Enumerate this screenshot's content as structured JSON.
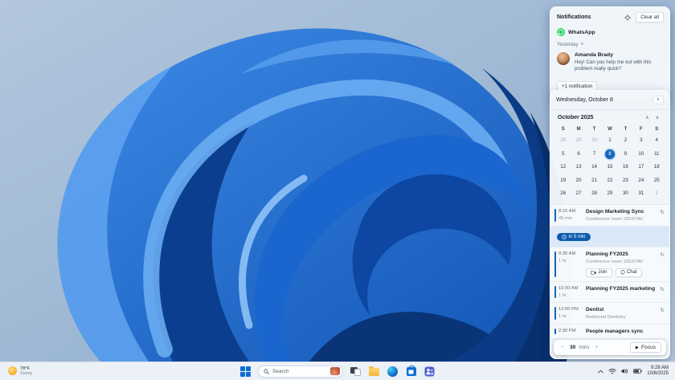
{
  "colors": {
    "accent": "#1466bc",
    "selected_day_bg": "#1266bc",
    "reminder_pill_bg": "#0f5cae",
    "whatsapp_green": "#25d366",
    "wallpaper_blue_bright": "#3e8ae8",
    "wallpaper_blue_dark": "#0b3b86",
    "panel_bg": "#f3f7fb",
    "taskbar_bg": "#eef2f8"
  },
  "icons": {
    "chevron_down": "∨",
    "chevron_up": "∧",
    "recurrence": "↻",
    "play": "▶",
    "minus": "−",
    "plus": "+"
  },
  "notifications": {
    "title": "Notifications",
    "clear_all_label": "Clear all",
    "app_group": {
      "name": "WhatsApp"
    },
    "section_label": "Yesterday",
    "message": {
      "sender": "Amanda Brady",
      "text": "Hey! Can you help me out with this problem really quick?"
    },
    "more_label": "+1 notification"
  },
  "calendar": {
    "date_header": "Wednesday, October 8",
    "month_label": "October 2025",
    "day_headers": [
      "S",
      "M",
      "T",
      "W",
      "T",
      "F",
      "S"
    ],
    "weeks": [
      [
        28,
        29,
        30,
        1,
        2,
        3,
        4
      ],
      [
        5,
        6,
        7,
        8,
        9,
        10,
        11
      ],
      [
        12,
        13,
        14,
        15,
        16,
        17,
        18
      ],
      [
        19,
        20,
        21,
        22,
        23,
        24,
        25
      ],
      [
        26,
        27,
        28,
        29,
        30,
        31,
        1
      ]
    ],
    "outside_month_cells": [
      [
        0,
        0
      ],
      [
        0,
        1
      ],
      [
        0,
        2
      ],
      [
        4,
        6
      ]
    ],
    "selected_cell": [
      1,
      3
    ],
    "selected_day": 8
  },
  "events": [
    {
      "time": "8:15 AM",
      "duration": "45 min",
      "title": "Design Marketing Sync",
      "location": "Conference room 16537/AV",
      "icon": "recurrence-icon",
      "badge": "in 5 min"
    },
    {
      "time": "9:30 AM",
      "duration": "1 hr",
      "title": "Planning FY2025",
      "location": "Conference room 16537/AV",
      "icon": "recurrence-icon",
      "buttons": [
        {
          "label": "Join",
          "icon": "camera-icon"
        },
        {
          "label": "Chat",
          "icon": "chat-icon"
        }
      ]
    },
    {
      "time": "10:30 AM",
      "duration": "1 hr",
      "title": "Planning FY2025 marketing",
      "icon": "recurrence-icon"
    },
    {
      "time": "12:00 PM",
      "duration": "1 hr",
      "title": "Dentist",
      "location": "Redmond Dentistry",
      "icon": "recurrence-icon"
    },
    {
      "time": "2:30 PM",
      "title": "People managers sync"
    }
  ],
  "focus_bar": {
    "minus_label": "−",
    "value": "30",
    "unit": "mins",
    "plus_label": "+",
    "focus_label": "Focus"
  },
  "taskbar": {
    "weather": {
      "temp": "78°F",
      "condition": "Sunny"
    },
    "search_placeholder": "Search",
    "tray": {
      "time": "9:28 AM",
      "date": "10/8/2025"
    }
  }
}
